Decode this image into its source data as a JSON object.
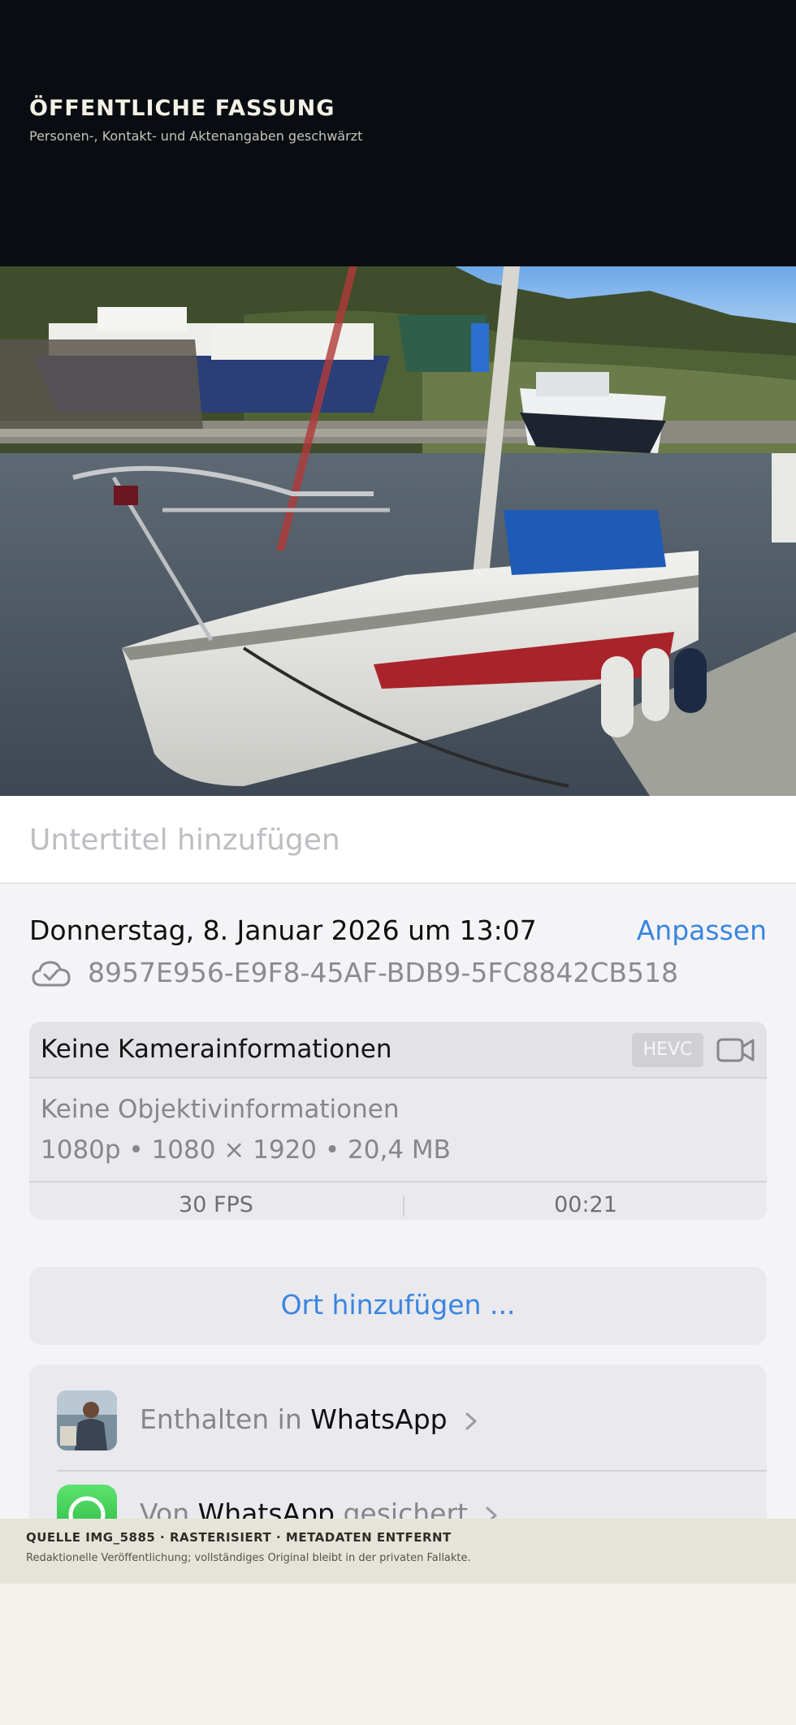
{
  "header": {
    "title": "ÖFFENTLICHE FASSUNG",
    "subtitle": "Personen-, Kontakt- und Aktenangaben geschwärzt"
  },
  "caption": {
    "placeholder": "Untertitel hinzufügen"
  },
  "info": {
    "date": "Donnerstag, 8. Januar 2026 um 13:07",
    "adjust_label": "Anpassen",
    "cloud_icon": "icloud-check-icon",
    "uuid": "8957E956-E9F8-45AF-BDB9-5FC8842CB518"
  },
  "camera": {
    "title": "Keine Kamerainformationen",
    "codec_badge": "HEVC",
    "video_icon": "video-camera-icon",
    "lens": "Keine Objektivinformationen",
    "specs": "1080p • 1080 × 1920 • 20,4 MB",
    "fps": "30 FPS",
    "duration": "00:21"
  },
  "location": {
    "label": "Ort hinzufügen ..."
  },
  "albums": [
    {
      "prefix": "Enthalten in ",
      "name": "WhatsApp",
      "suffix": ""
    },
    {
      "prefix": "Von ",
      "name": "WhatsApp",
      "suffix": " gesichert"
    }
  ],
  "footer": {
    "title": "QUELLE IMG_5885 · RASTERISIERT · METADATEN ENTFERNT",
    "subtitle": "Redaktionelle Veröffentlichung; vollständiges Original bleibt in der privaten Fallakte."
  },
  "colors": {
    "accent": "#3a85e0",
    "header_bg": "#090c11",
    "footer_bg": "#e6e4d9",
    "sheet_bg": "#f4f4f7",
    "card_bg": "#e9e9ee"
  }
}
